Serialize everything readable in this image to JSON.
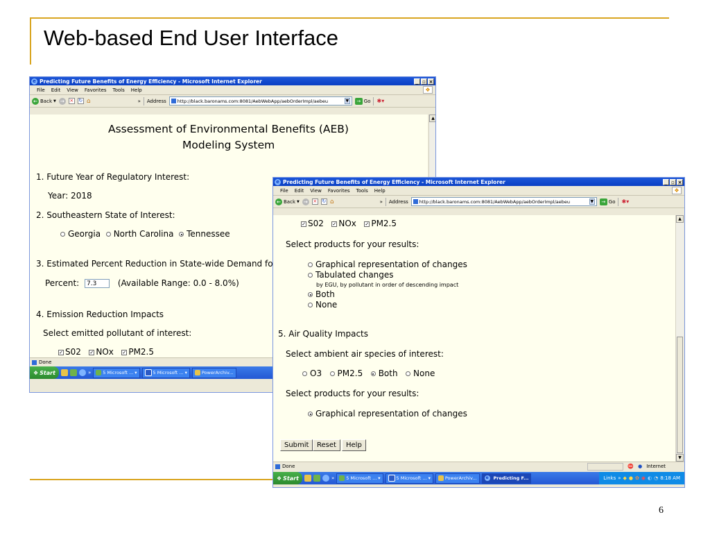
{
  "slide": {
    "title": "Web-based End User Interface",
    "page_number": "6",
    "accent_color": "#d9a520"
  },
  "browser": {
    "window_title": "Predicting Future Benefits of Energy Efficiency - Microsoft Internet Explorer",
    "menu": [
      "File",
      "Edit",
      "View",
      "Favorites",
      "Tools",
      "Help"
    ],
    "back_label": "Back",
    "chevron": "»",
    "address_label": "Address",
    "url": "http://black.baronams.com:8081/AebWebApp/aebOrderImpl/aebeu",
    "go_label": "Go",
    "win_min": "_",
    "win_max": "▫",
    "win_close": "×"
  },
  "window1": {
    "heading_line1": "Assessment of Environmental Benefits (AEB)",
    "heading_line2": "Modeling System",
    "q1": "1. Future Year of Regulatory Interest:",
    "year_text": "Year: 2018",
    "q2": "2. Southeastern State of Interest:",
    "states": [
      "Georgia",
      "North Carolina",
      "Tennessee"
    ],
    "selected_state": "Tennessee",
    "q3": "3. Estimated Percent Reduction in State-wide Demand fo",
    "percent_label": "Percent:",
    "percent_value": "7.3",
    "range_text": "(Available Range: 0.0 - 8.0%)",
    "q4": "4. Emission Reduction Impacts",
    "pollutant_prompt": "Select emitted pollutant of interest:",
    "pollutants": [
      "S02",
      "NOx",
      "PM2.5"
    ],
    "status": "Done"
  },
  "window2": {
    "pollutants": [
      "S02",
      "NOx",
      "PM2.5"
    ],
    "products_prompt": "Select products for your results:",
    "products": [
      "Graphical representation of changes",
      "Tabulated changes",
      "Both",
      "None"
    ],
    "tabulated_note": "by EGU, by pollutant in order of descending impact",
    "selected_product": "Both",
    "q5": "5. Air Quality Impacts",
    "species_prompt": "Select ambient air species of interest:",
    "species": [
      "O3",
      "PM2.5",
      "Both",
      "None"
    ],
    "selected_species": "Both",
    "products_prompt2": "Select products for your results:",
    "aq_product": "Graphical representation of changes",
    "buttons": {
      "submit": "Submit",
      "reset": "Reset",
      "help": "Help"
    },
    "status": "Done",
    "zone": "Internet"
  },
  "taskbar": {
    "start": "Start",
    "tasks": [
      "5 Microsoft ...",
      "5 Microsoft ...",
      "PowerArchiv...",
      "Predicting F..."
    ],
    "links": "Links",
    "clock": "8:18 AM"
  }
}
